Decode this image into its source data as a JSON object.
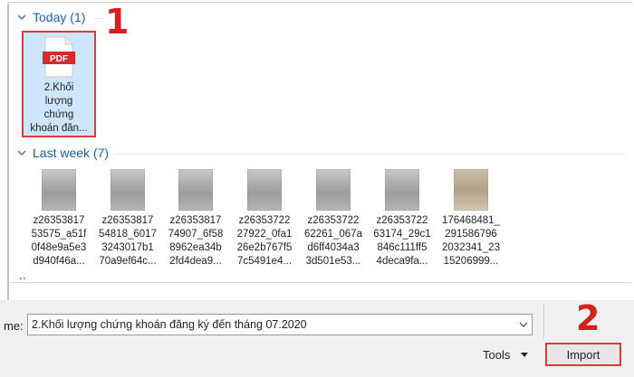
{
  "groups": {
    "today": {
      "label": "Today (1)"
    },
    "last_week": {
      "label": "Last week (7)"
    }
  },
  "today_files": [
    {
      "badge": "PDF",
      "name": "2.Khối\nlượng\nchứng\nkhoán đăn..."
    }
  ],
  "last_week_files": [
    {
      "name": "z26353817\n53575_a51f\n0f48e9a5e3\nd940f46a..."
    },
    {
      "name": "z26353817\n54818_6017\n3243017b1\n70a9ef64c..."
    },
    {
      "name": "z26353817\n74907_6f58\n8962ea34b\n2fd4dea9..."
    },
    {
      "name": "z26353722\n27922_0fa1\n26e2b767f5\n7c5491e4..."
    },
    {
      "name": "z26353722\n62261_067a\nd6ff4034a3\n3d501e53..."
    },
    {
      "name": "z26353722\n63174_29c1\n846c111ff5\n4deca9fa..."
    },
    {
      "name": "176468481_\n291586796\n2032341_23\n15206999..."
    }
  ],
  "footer": {
    "filename_label": "me:",
    "filename_value": "2.Khối lượng chứng khoán đăng ký đến tháng 07.2020",
    "tools_label": "Tools",
    "import_label": "Import"
  },
  "steps": {
    "one": "1",
    "two": "2"
  },
  "colors": {
    "accent": "#1b5fa8",
    "highlight": "#d93a3a",
    "selection": "#cfe5fb"
  }
}
